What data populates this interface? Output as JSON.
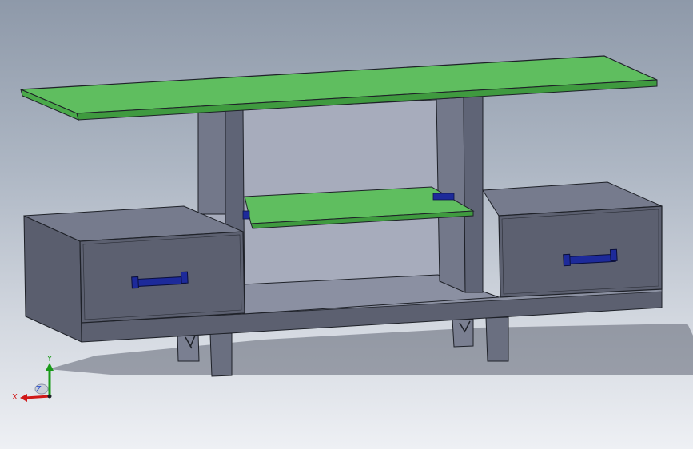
{
  "viewport": {
    "background_top": "#8e99a9",
    "background_bottom": "#eef0f4"
  },
  "model": {
    "shelf_color": "#5fbe5f",
    "shelf_edge_color": "#3f9a3f",
    "body_color": "#5c6070",
    "body_light_color": "#7a7f91",
    "post_color": "#6d7284",
    "handle_color": "#1d2a9a",
    "outline_color": "#1e2128"
  },
  "triad": {
    "x_label": "X",
    "y_label": "Y",
    "z_label": "Z",
    "x_color": "#d01818",
    "y_color": "#1a9a1a",
    "z_color": "#2a4fd0"
  }
}
